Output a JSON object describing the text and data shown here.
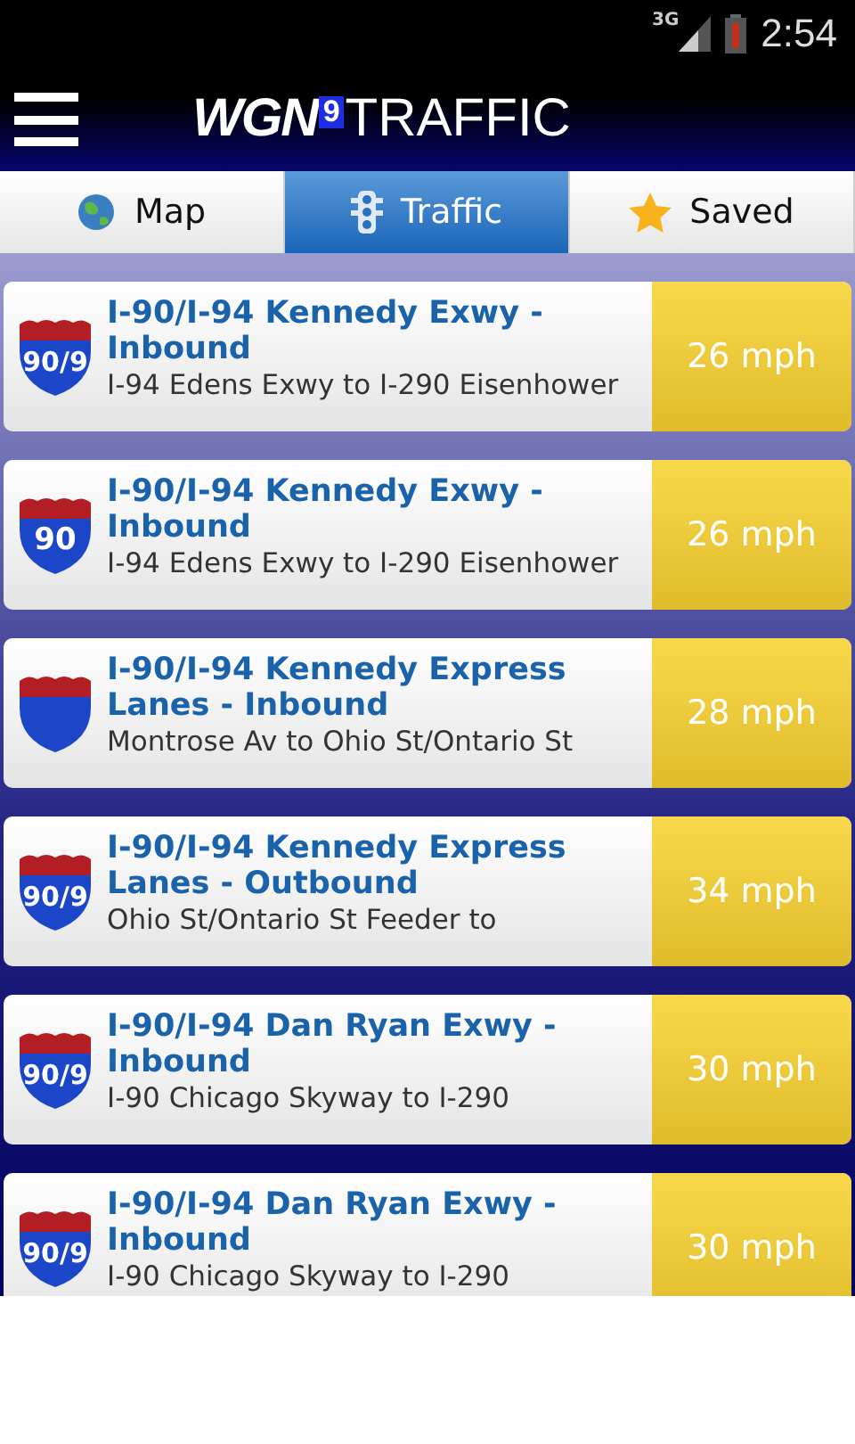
{
  "status_bar": {
    "network": "3G",
    "time": "2:54"
  },
  "header": {
    "logo": {
      "brand": "WGN",
      "channel": "9",
      "product": "TRAFFIC"
    }
  },
  "tabs": [
    {
      "label": "Map",
      "kind": "map",
      "selected": false
    },
    {
      "label": "Traffic",
      "kind": "traffic",
      "selected": true
    },
    {
      "label": "Saved",
      "kind": "saved",
      "selected": false
    }
  ],
  "routes": [
    {
      "shield": "90/9",
      "title": "I-90/I-94 Kennedy Exwy - Inbound",
      "segment": "I-94 Edens Exwy to I-290 Eisenhower",
      "speed": "26 mph"
    },
    {
      "shield": "90",
      "title": "I-90/I-94 Kennedy Exwy - Inbound",
      "segment": "I-94 Edens Exwy to I-290 Eisenhower",
      "speed": "26 mph"
    },
    {
      "title": "I-90/I-94 Kennedy Express Lanes - Inbound",
      "segment": "Montrose Av to Ohio St/Ontario St",
      "speed": "28 mph"
    },
    {
      "shield": "90/9",
      "title": "I-90/I-94 Kennedy Express Lanes - Outbound",
      "segment": "Ohio St/Ontario St Feeder to",
      "speed": "34 mph"
    },
    {
      "shield": "90/9",
      "title": "I-90/I-94 Dan Ryan Exwy - Inbound",
      "segment": "I-90 Chicago Skyway to I-290",
      "speed": "30 mph"
    },
    {
      "shield": "90/9",
      "title": "I-90/I-94 Dan Ryan Exwy - Inbound",
      "segment": "I-90 Chicago Skyway to I-290",
      "speed": "30 mph"
    }
  ]
}
